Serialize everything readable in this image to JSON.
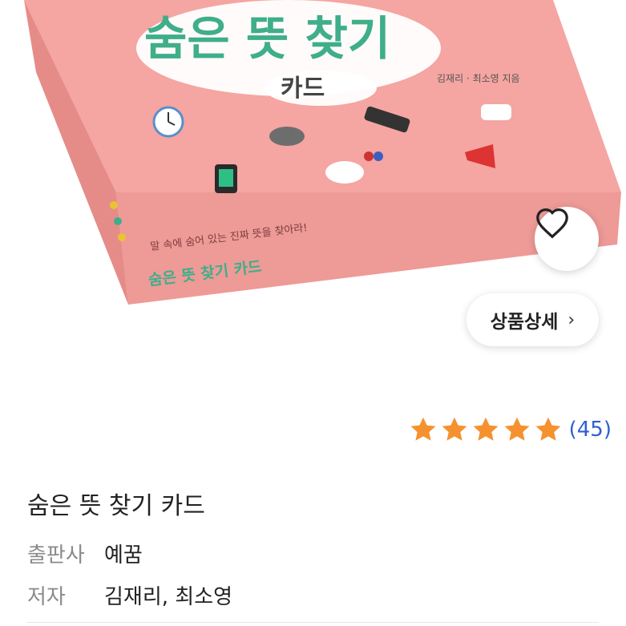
{
  "product_image": {
    "box_title": "숨은 뜻 찾기",
    "box_subtitle": "카드",
    "box_authors": "김재리 · 최소영 지음",
    "box_front_tagline": "말 속에 숨어 있는 진짜 뜻을 찾아라!",
    "box_front_title": "숨은 뜻 찾기 카드",
    "box_color": "#f4a3a0"
  },
  "favorite": {
    "icon": "heart-outline-icon"
  },
  "detail_button": {
    "label": "상품상세",
    "chevron": "›"
  },
  "rating": {
    "stars": 5,
    "max_stars": 5,
    "count_text": "(45)",
    "star_color": "#f5922f"
  },
  "product": {
    "title": "숨은 뜻 찾기 카드",
    "publisher_label": "출판사",
    "publisher": "예꿈",
    "author_label": "저자",
    "authors": "김재리, 최소영"
  }
}
